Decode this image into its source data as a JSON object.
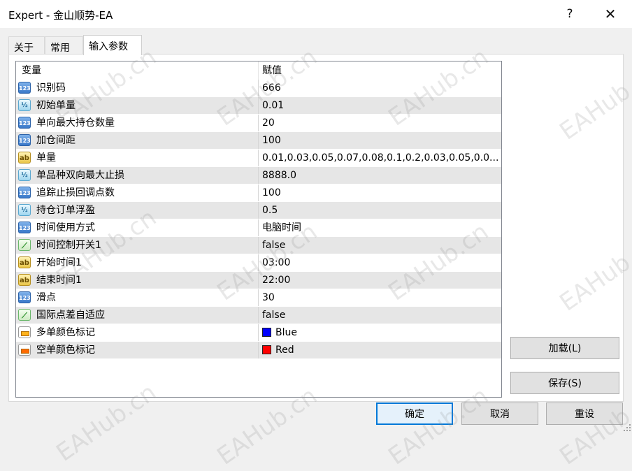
{
  "window": {
    "title": "Expert - 金山顺势-EA",
    "help_label": "?",
    "close_label": "✕"
  },
  "tabs": [
    {
      "label": "关于",
      "active": false
    },
    {
      "label": "常用",
      "active": false
    },
    {
      "label": "输入参数",
      "active": true
    }
  ],
  "grid": {
    "columns": {
      "variable": "变量",
      "value": "赋值"
    },
    "rows": [
      {
        "type": "int",
        "icon": "int-icon",
        "name": "识别码",
        "value": "666"
      },
      {
        "type": "double",
        "icon": "double-icon",
        "name": "初始单量",
        "value": "0.01"
      },
      {
        "type": "int",
        "icon": "int-icon",
        "name": "单向最大持仓数量",
        "value": "20"
      },
      {
        "type": "int",
        "icon": "int-icon",
        "name": "加仓间距",
        "value": "100"
      },
      {
        "type": "string",
        "icon": "string-icon",
        "name": "单量",
        "value": "0.01,0.03,0.05,0.07,0.08,0.1,0.2,0.03,0.05,0.0..."
      },
      {
        "type": "double",
        "icon": "double-icon",
        "name": "单品种双向最大止损",
        "value": "8888.0"
      },
      {
        "type": "int",
        "icon": "int-icon",
        "name": "追踪止损回调点数",
        "value": "100"
      },
      {
        "type": "double",
        "icon": "double-icon",
        "name": "持仓订单浮盈",
        "value": "0.5"
      },
      {
        "type": "int",
        "icon": "int-icon",
        "name": "时间使用方式",
        "value": "电脑时间"
      },
      {
        "type": "bool",
        "icon": "bool-icon",
        "name": "时间控制开关1",
        "value": "false"
      },
      {
        "type": "string",
        "icon": "string-icon",
        "name": "开始时间1",
        "value": "03:00"
      },
      {
        "type": "string",
        "icon": "string-icon",
        "name": "结束时间1",
        "value": "22:00"
      },
      {
        "type": "int",
        "icon": "int-icon",
        "name": "滑点",
        "value": "30"
      },
      {
        "type": "bool",
        "icon": "bool-icon",
        "name": "国际点差自适应",
        "value": "false"
      },
      {
        "type": "color",
        "icon": "color-icon",
        "name": "多单颜色标记",
        "value": "Blue",
        "swatch": "#0000ff"
      },
      {
        "type": "color",
        "icon": "color-icon",
        "name": "空单颜色标记",
        "value": "Red",
        "swatch": "#ff0000"
      }
    ]
  },
  "icon_glyphs": {
    "int": "123",
    "double": "½",
    "string": "ab",
    "bool": "⟋",
    "color": ""
  },
  "buttons": {
    "load": "加载(L)",
    "save": "保存(S)",
    "ok": "确定",
    "cancel": "取消",
    "reset": "重设"
  },
  "colors": {
    "accent": "#0078d7",
    "row_alt": "#e6e6e6"
  },
  "watermark": "EAHub.cn"
}
